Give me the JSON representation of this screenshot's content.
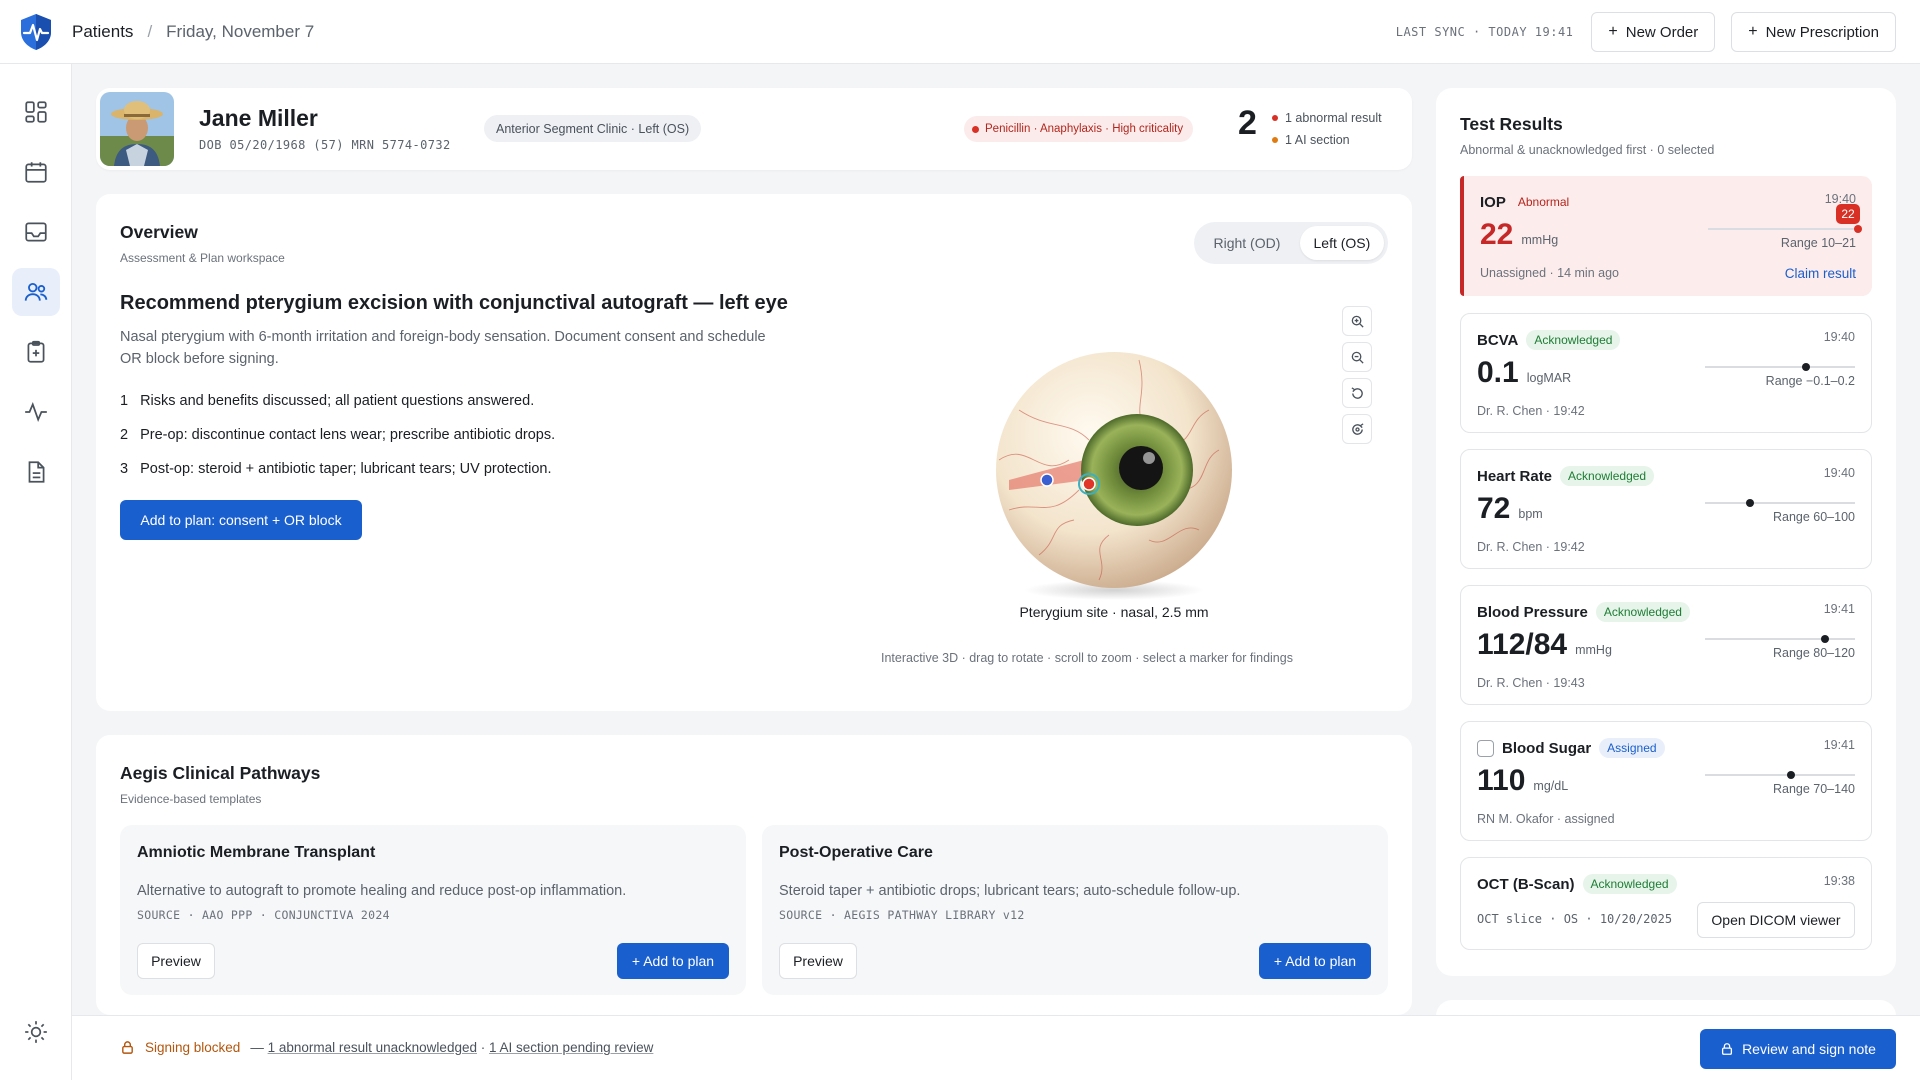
{
  "header": {
    "breadcrumb_root": "Patients",
    "breadcrumb_sep": "/",
    "breadcrumb_date": "Friday, November 7",
    "last_sync": "LAST SYNC · TODAY 19:41",
    "new_order": "New Order",
    "new_prescription": "New Prescription",
    "plus": "+"
  },
  "sidebar": {
    "items": [
      {
        "icon": "dashboard-icon"
      },
      {
        "icon": "calendar-icon"
      },
      {
        "icon": "inbox-icon"
      },
      {
        "icon": "patients-icon",
        "active": true
      },
      {
        "icon": "clipboard-icon"
      },
      {
        "icon": "activity-icon"
      },
      {
        "icon": "document-icon"
      },
      {
        "icon": "theme-sun-icon"
      }
    ]
  },
  "patient": {
    "name": "Jane Miller",
    "meta": "DOB 05/20/1968 (57) MRN 5774-0732",
    "clinic": "Anterior Segment Clinic · Left (OS)",
    "allergy": "Penicillin · Anaphylaxis · High criticality",
    "alert_count": "2",
    "alerts": [
      "1 abnormal result",
      "1 AI section"
    ]
  },
  "overview": {
    "title": "Overview",
    "subtitle": "Assessment & Plan workspace",
    "eye_right": "Right (OD)",
    "eye_left": "Left (OS)",
    "rec_title": "Recommend pterygium excision with conjunctival autograft — left eye",
    "rec_desc": "Nasal pterygium with 6-month irritation and foreign-body sensation. Document consent and schedule OR block before signing.",
    "steps": [
      {
        "num": "1",
        "text": "Risks and benefits discussed; all patient questions answered."
      },
      {
        "num": "2",
        "text": "Pre-op: discontinue contact lens wear; prescribe antibiotic drops."
      },
      {
        "num": "3",
        "text": "Post-op: steroid + antibiotic taper; lubricant tears; UV protection."
      }
    ],
    "add_button": "Add to plan: consent + OR block",
    "eye_caption": "Pterygium site · nasal, 2.5 mm",
    "eye_hint": "Interactive 3D · drag to rotate · scroll to zoom · select a marker for findings"
  },
  "pathways": {
    "title": "Aegis Clinical Pathways",
    "subtitle": "Evidence-based templates",
    "cards": [
      {
        "title": "Amniotic Membrane Transplant",
        "desc": "Alternative to autograft to promote healing and reduce post-op inflammation.",
        "source": "SOURCE · AAO PPP · CONJUNCTIVA 2024",
        "preview": "Preview",
        "add": "+ Add to plan"
      },
      {
        "title": "Post-Operative Care",
        "desc": "Steroid taper + antibiotic drops; lubricant tears; auto-schedule follow-up.",
        "source": "SOURCE · AEGIS PATHWAY LIBRARY v12",
        "preview": "Preview",
        "add": "+ Add to plan"
      }
    ]
  },
  "results": {
    "title": "Test Results",
    "subtitle": "Abnormal & unacknowledged first · 0 selected",
    "items": [
      {
        "name": "IOP",
        "status": "Abnormal",
        "time": "19:40",
        "value": "22",
        "unit": "mmHg",
        "range": "Range 10–21",
        "foot": "Unassigned · 14 min ago",
        "claim": "Claim result",
        "pin": "22",
        "level": 1.0
      },
      {
        "name": "BCVA",
        "status": "Acknowledged",
        "time": "19:40",
        "value": "0.1",
        "unit": "logMAR",
        "range": "Range −0.1–0.2",
        "foot": "Dr. R. Chen · 19:42",
        "level": 0.67
      },
      {
        "name": "Heart Rate",
        "status": "Acknowledged",
        "time": "19:40",
        "value": "72",
        "unit": "bpm",
        "range": "Range 60–100",
        "foot": "Dr. R. Chen · 19:42",
        "level": 0.3
      },
      {
        "name": "Blood Pressure",
        "status": "Acknowledged",
        "time": "19:41",
        "value": "112/84",
        "unit": "mmHg",
        "range": "Range 80–120",
        "foot": "Dr. R. Chen · 19:43",
        "level": 0.8
      },
      {
        "name": "Blood Sugar",
        "status": "Assigned",
        "time": "19:41",
        "value": "110",
        "unit": "mg/dL",
        "range": "Range 70–140",
        "foot": "RN M. Okafor · assigned",
        "level": 0.57
      },
      {
        "name": "OCT (B-Scan)",
        "status": "Acknowledged",
        "time": "19:38",
        "meta": "OCT slice · OS · 10/20/2025",
        "button": "Open DICOM viewer"
      }
    ]
  },
  "footer": {
    "blocked_label": "Signing blocked",
    "dash": "—",
    "link1": "1 abnormal result unacknowledged",
    "dot": "·",
    "link2": "1 AI section pending review",
    "sign_button": "Review and sign note"
  },
  "colors": {
    "accent": "#1a5fce",
    "danger": "#c62828",
    "success": "#1e7d34",
    "warning": "#b3560e"
  }
}
